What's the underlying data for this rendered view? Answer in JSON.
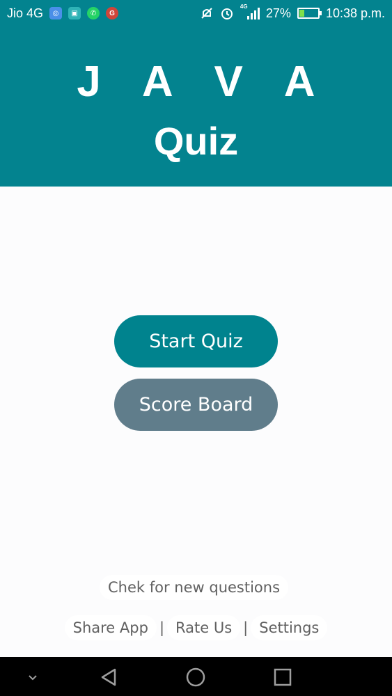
{
  "status_bar": {
    "carrier": "Jio 4G",
    "network": "4G",
    "battery": "27%",
    "battery_level": 0.27,
    "time": "10:38 p.m.",
    "notification_icons": [
      "shield-app-icon",
      "android-app-icon",
      "whatsapp-icon",
      "google-plus-icon"
    ],
    "system_icons": [
      "mute-icon",
      "alarm-icon",
      "signal-icon",
      "battery-charging-icon"
    ]
  },
  "header": {
    "title_line1": "J A V A",
    "title_line2": "Quiz"
  },
  "main": {
    "start_label": "Start Quiz",
    "score_label": "Score Board"
  },
  "footer": {
    "check_label": "Chek for new questions",
    "share_label": "Share App",
    "rate_label": "Rate Us",
    "settings_label": "Settings",
    "separator": "|"
  },
  "colors": {
    "primary": "#03838f",
    "secondary": "#607d8b",
    "background": "#fcfcfd",
    "link_text": "#616161"
  },
  "navbar": {
    "icons": [
      "chevron-down-icon",
      "back-icon",
      "home-icon",
      "recents-icon"
    ]
  }
}
